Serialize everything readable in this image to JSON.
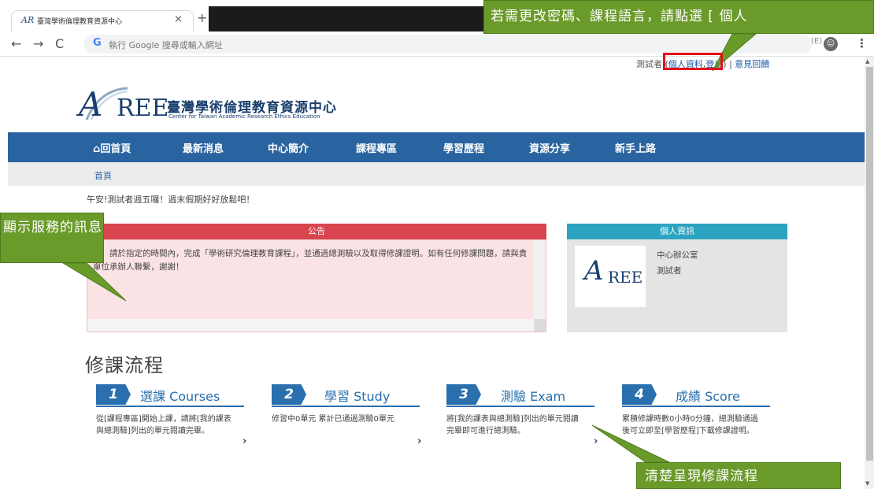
{
  "browser": {
    "tab_title": "臺灣學術倫理教育資源中心",
    "tab_favicon": "AR",
    "tab_close": "×",
    "new_tab": "+",
    "back": "←",
    "forward": "→",
    "reload": "C",
    "omnibox_icon": "G",
    "omnibox_placeholder": "執行 Google 搜尋或輸入網址",
    "toolbar_right_text": "(E)",
    "profile_icon": "person-icon",
    "menu_dots": "⋮"
  },
  "header": {
    "user_label": "測試者",
    "profile_link": "個人資料",
    "logout_link": "登出",
    "feedback_link": "意見回饋"
  },
  "logo": {
    "mark_a": "A",
    "mark_ree": "REE",
    "name_cn": "臺灣學術倫理教育資源中心",
    "name_en": "Center for Taiwan Academic Research Ethics Education"
  },
  "nav": {
    "items": [
      {
        "label": "回首頁",
        "icon": "home-icon"
      },
      {
        "label": "最新消息"
      },
      {
        "label": "中心簡介"
      },
      {
        "label": "課程專區"
      },
      {
        "label": "學習歷程"
      },
      {
        "label": "資源分享"
      },
      {
        "label": "新手上路"
      }
    ]
  },
  "breadcrumb": "首頁",
  "greeting": "午安!測試者週五囉！週末假期好好放鬆吧！",
  "announcement": {
    "title": "公告",
    "body": "好：請於指定的時間內，完成「學術研究倫理教育課程」，並通過總測驗以及取得修課證明。如有任何修課問題，請與貴單位承辦人聯繫，謝謝！"
  },
  "profile": {
    "title": "個人資訊",
    "photo_a": "A",
    "photo_ree": "REE",
    "org": "中心辦公室",
    "name": "測試者"
  },
  "flow": {
    "title": "修課流程",
    "steps": [
      {
        "num": "1",
        "label": "選課 Courses",
        "desc": "從[課程專區]開始上課，請將[我的課表與總測驗]列出的單元閱讀完畢。"
      },
      {
        "num": "2",
        "label": "學習 Study",
        "desc": "修習中0單元 累計已通過測驗0單元"
      },
      {
        "num": "3",
        "label": "測驗 Exam",
        "desc": "將[我的課表與總測驗]列出的單元閱讀完畢即可進行總測驗。"
      },
      {
        "num": "4",
        "label": "成績 Score",
        "desc": "累積修課時數0小時0分鐘，總測驗通過後可立即至[學習歷程]下載修課證明。"
      }
    ],
    "arrow": "›"
  },
  "callouts": {
    "top": "若需更改密碼、課程語言，請點選 [ 個人",
    "left": "顯示服務的訊息",
    "bottom": "清楚呈現修課流程"
  },
  "colors": {
    "nav_bg": "#2a64a0",
    "announcement_head": "#d9454e",
    "profile_head": "#2ca3bf",
    "callout_green": "#6a9a2a",
    "highlight_red": "#e0101a"
  }
}
